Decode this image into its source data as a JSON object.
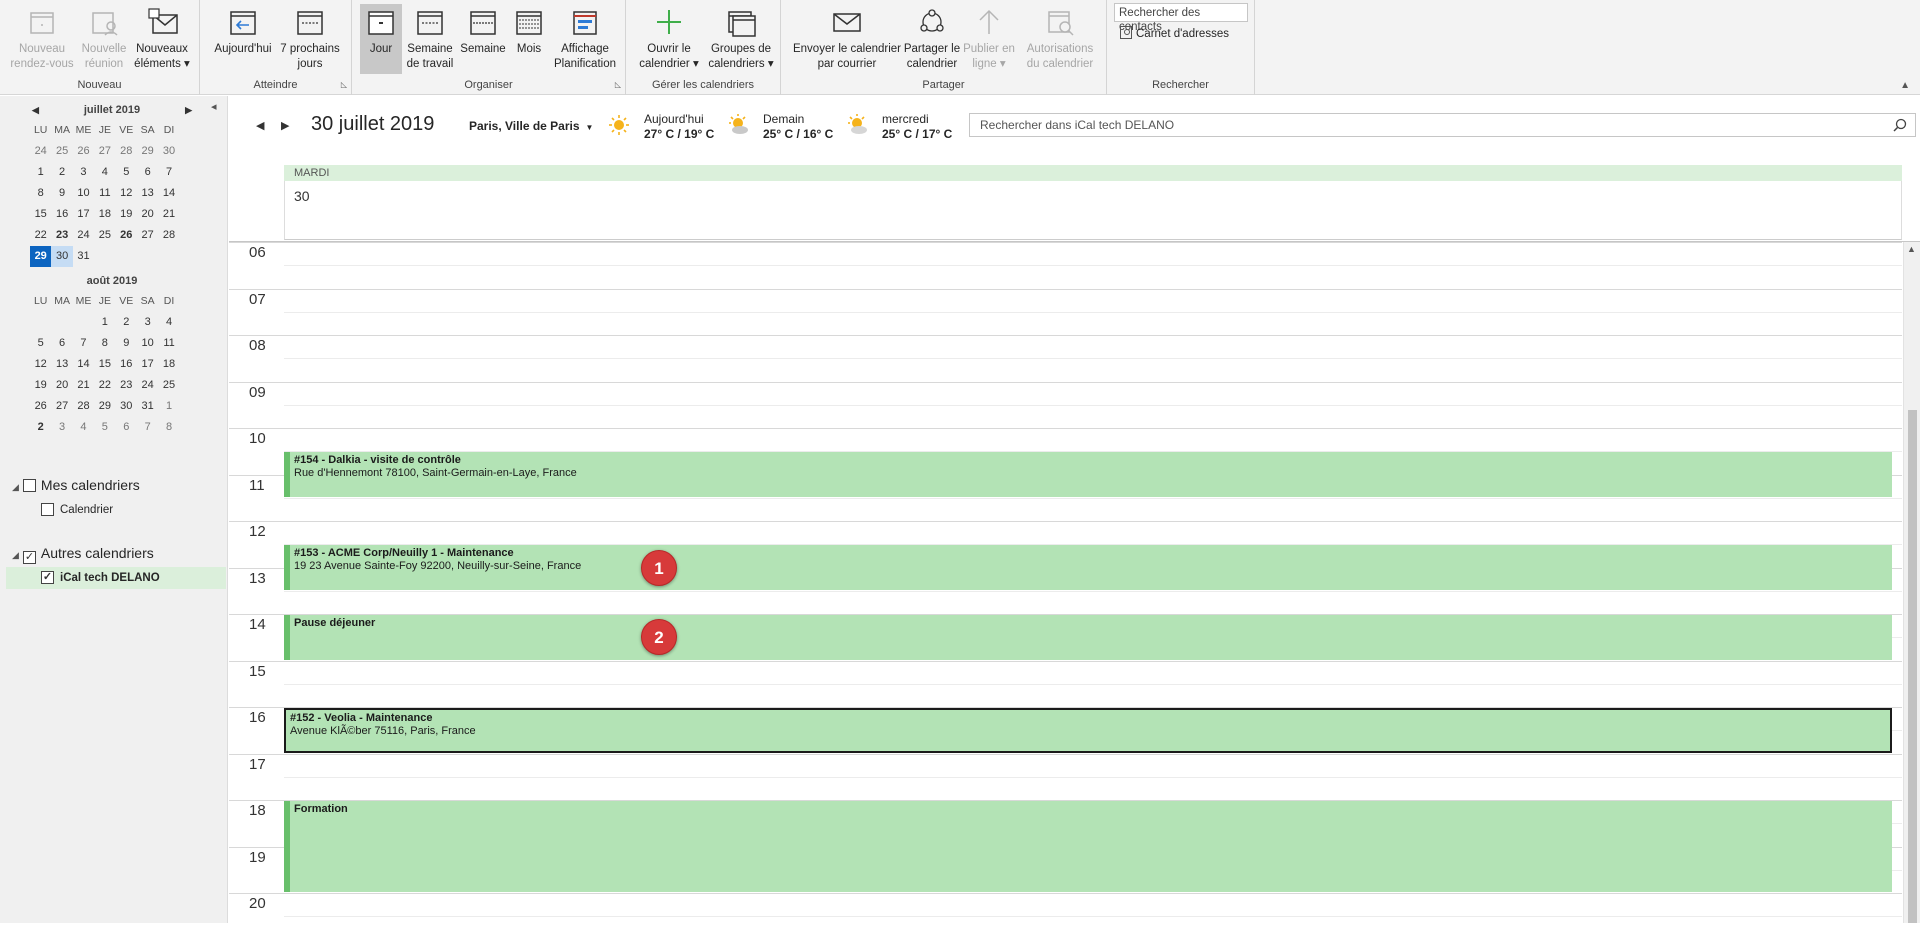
{
  "ribbon": {
    "groups": {
      "nouveau": "Nouveau",
      "atteindre": "Atteindre",
      "organiser": "Organiser",
      "gerer": "Gérer les calendriers",
      "partager": "Partager",
      "rechercher": "Rechercher"
    },
    "buttons": {
      "new_appointment": "Nouveau\nrendez-vous",
      "new_meeting": "Nouvelle\nréunion",
      "new_items": "Nouveaux\néléments ▾",
      "today": "Aujourd'hui",
      "next7": "7 prochains\njours",
      "day": "Jour",
      "work_week": "Semaine\nde travail",
      "week": "Semaine",
      "month": "Mois",
      "schedule": "Affichage\nPlanification",
      "open_calendar": "Ouvrir le\ncalendrier ▾",
      "calendar_groups": "Groupes de\ncalendriers ▾",
      "email_calendar": "Envoyer le calendrier\npar courrier",
      "share_calendar": "Partager le\ncalendrier",
      "publish_online": "Publier en\nligne ▾",
      "calendar_permissions": "Autorisations\ndu calendrier"
    },
    "search_contacts_placeholder": "Rechercher des contacts",
    "address_book": "Carnet d'adresses"
  },
  "minical": {
    "dow": [
      "LU",
      "MA",
      "ME",
      "JE",
      "VE",
      "SA",
      "DI"
    ],
    "months": [
      {
        "title": "juillet 2019",
        "days": [
          {
            "d": "24",
            "c": "other"
          },
          {
            "d": "25",
            "c": "other"
          },
          {
            "d": "26",
            "c": "other"
          },
          {
            "d": "27",
            "c": "other"
          },
          {
            "d": "28",
            "c": "other"
          },
          {
            "d": "29",
            "c": "other"
          },
          {
            "d": "30",
            "c": "other"
          },
          {
            "d": "1"
          },
          {
            "d": "2"
          },
          {
            "d": "3"
          },
          {
            "d": "4"
          },
          {
            "d": "5"
          },
          {
            "d": "6"
          },
          {
            "d": "7"
          },
          {
            "d": "8"
          },
          {
            "d": "9"
          },
          {
            "d": "10"
          },
          {
            "d": "11"
          },
          {
            "d": "12"
          },
          {
            "d": "13"
          },
          {
            "d": "14"
          },
          {
            "d": "15"
          },
          {
            "d": "16"
          },
          {
            "d": "17"
          },
          {
            "d": "18"
          },
          {
            "d": "19"
          },
          {
            "d": "20"
          },
          {
            "d": "21"
          },
          {
            "d": "22"
          },
          {
            "d": "23",
            "c": "bold"
          },
          {
            "d": "24"
          },
          {
            "d": "25"
          },
          {
            "d": "26",
            "c": "bold"
          },
          {
            "d": "27"
          },
          {
            "d": "28"
          },
          {
            "d": "29",
            "c": "today"
          },
          {
            "d": "30",
            "c": "selected"
          },
          {
            "d": "31"
          }
        ]
      },
      {
        "title": "août 2019",
        "days": [
          {
            "d": ""
          },
          {
            "d": ""
          },
          {
            "d": ""
          },
          {
            "d": "1"
          },
          {
            "d": "2"
          },
          {
            "d": "3"
          },
          {
            "d": "4"
          },
          {
            "d": "5"
          },
          {
            "d": "6"
          },
          {
            "d": "7"
          },
          {
            "d": "8"
          },
          {
            "d": "9"
          },
          {
            "d": "10"
          },
          {
            "d": "11"
          },
          {
            "d": "12"
          },
          {
            "d": "13"
          },
          {
            "d": "14"
          },
          {
            "d": "15"
          },
          {
            "d": "16"
          },
          {
            "d": "17"
          },
          {
            "d": "18"
          },
          {
            "d": "19"
          },
          {
            "d": "20"
          },
          {
            "d": "21"
          },
          {
            "d": "22"
          },
          {
            "d": "23"
          },
          {
            "d": "24"
          },
          {
            "d": "25"
          },
          {
            "d": "26"
          },
          {
            "d": "27"
          },
          {
            "d": "28"
          },
          {
            "d": "29"
          },
          {
            "d": "30"
          },
          {
            "d": "31"
          },
          {
            "d": "1",
            "c": "other"
          },
          {
            "d": "2",
            "c": "bold"
          },
          {
            "d": "3",
            "c": "other"
          },
          {
            "d": "4",
            "c": "other"
          },
          {
            "d": "5",
            "c": "other"
          },
          {
            "d": "6",
            "c": "other"
          },
          {
            "d": "7",
            "c": "other"
          },
          {
            "d": "8",
            "c": "other"
          }
        ]
      }
    ]
  },
  "calendars": {
    "my_calendars": "Mes calendriers",
    "calendar_item": "Calendrier",
    "other_calendars": "Autres calendriers",
    "ical_item": "iCal tech DELANO"
  },
  "view": {
    "current_date": "30 juillet 2019",
    "location": "Paris, Ville de Paris",
    "weather": [
      {
        "label": "Aujourd'hui",
        "temp": "27° C / 19° C"
      },
      {
        "label": "Demain",
        "temp": "25° C / 16° C"
      },
      {
        "label": "mercredi",
        "temp": "25° C / 17° C"
      }
    ],
    "search_placeholder": "Rechercher dans iCal tech DELANO",
    "day_name": "MARDI",
    "day_number": "30",
    "hours": [
      "06",
      "07",
      "08",
      "09",
      "10",
      "11",
      "12",
      "13",
      "14",
      "15",
      "16",
      "17",
      "18",
      "19",
      "20"
    ],
    "events": [
      {
        "title": "#154 - Dalkia - visite de contrôle",
        "location": "Rue d'Hennemont 78100, Saint-Germain-en-Laye, France",
        "start": 10.5,
        "end": 11.5
      },
      {
        "title": "#153 - ACME Corp/Neuilly 1 - Maintenance",
        "location": "19 23 Avenue Sainte-Foy 92200, Neuilly-sur-Seine, France",
        "start": 12.5,
        "end": 13.5
      },
      {
        "title": "Pause déjeuner",
        "location": "",
        "start": 14.0,
        "end": 15.0
      },
      {
        "title": "#152 - Veolia - Maintenance",
        "location": "Avenue KlÃ©ber 75116, Paris, France",
        "start": 16.0,
        "end": 17.0,
        "selected": true
      },
      {
        "title": "Formation",
        "location": "",
        "start": 18.0,
        "end": 20.0
      }
    ],
    "badges": [
      {
        "label": "1",
        "hour": 13.0
      },
      {
        "label": "2",
        "hour": 14.5
      }
    ]
  },
  "colors": {
    "accent": "#0c64c0",
    "event_bg": "#b3e3b5",
    "event_border": "#68bf6b",
    "badge": "#d73a3a"
  }
}
